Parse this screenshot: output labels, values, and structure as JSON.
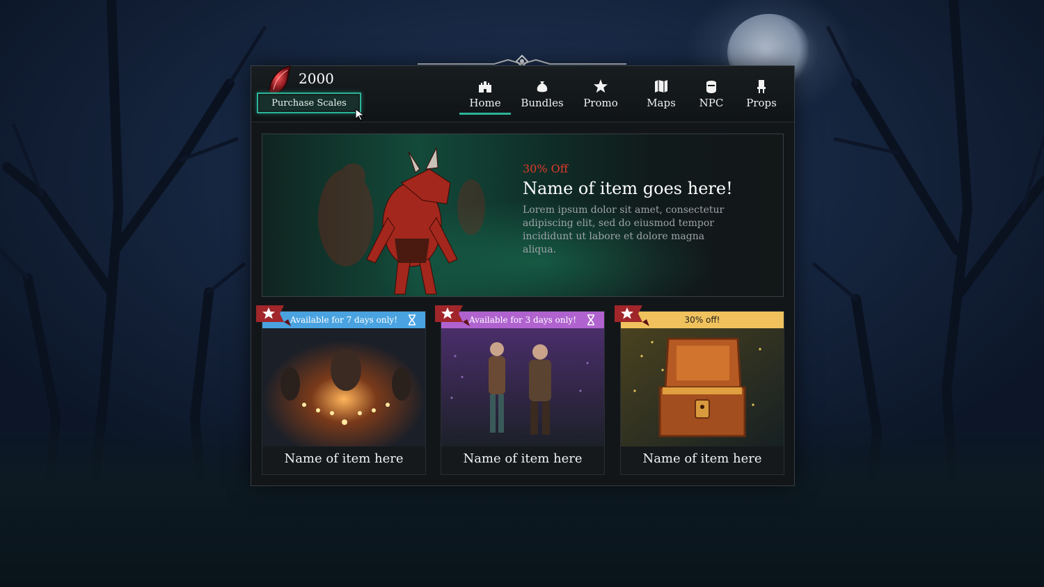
{
  "currency": {
    "value": "2000",
    "icon": "dragon-scale-icon"
  },
  "purchase_label": "Purchase Scales",
  "nav": [
    {
      "label": "Home",
      "icon": "castle-icon",
      "active": true
    },
    {
      "label": "Bundles",
      "icon": "pouch-icon",
      "active": false
    },
    {
      "label": "Promo",
      "icon": "star-icon",
      "active": false
    },
    {
      "label": "Maps",
      "icon": "map-icon",
      "active": false
    },
    {
      "label": "NPC",
      "icon": "helmet-icon",
      "active": false
    },
    {
      "label": "Props",
      "icon": "chair-icon",
      "active": false
    }
  ],
  "hero": {
    "discount": "30% Off",
    "title": "Name of item goes here!",
    "description": "Lorem ipsum dolor sit amet, consectetur adipiscing elit, sed do eiusmod tempor incididunt ut labore et dolore magna aliqua."
  },
  "cards": [
    {
      "banner": "Available for 7 days only!",
      "banner_color": "#4aa3e0",
      "name": "Name of item here",
      "timer_icon": "hourglass-icon"
    },
    {
      "banner": "Available for 3 days only!",
      "banner_color": "#b063cf",
      "name": "Name of item here",
      "timer_icon": "hourglass-icon"
    },
    {
      "banner": "30% off!",
      "banner_color": "#f0c25e",
      "name": "Name of item here"
    }
  ],
  "colors": {
    "accent": "#2bb39a",
    "discount": "#e23a2c",
    "ribbon": "#a0262a"
  }
}
